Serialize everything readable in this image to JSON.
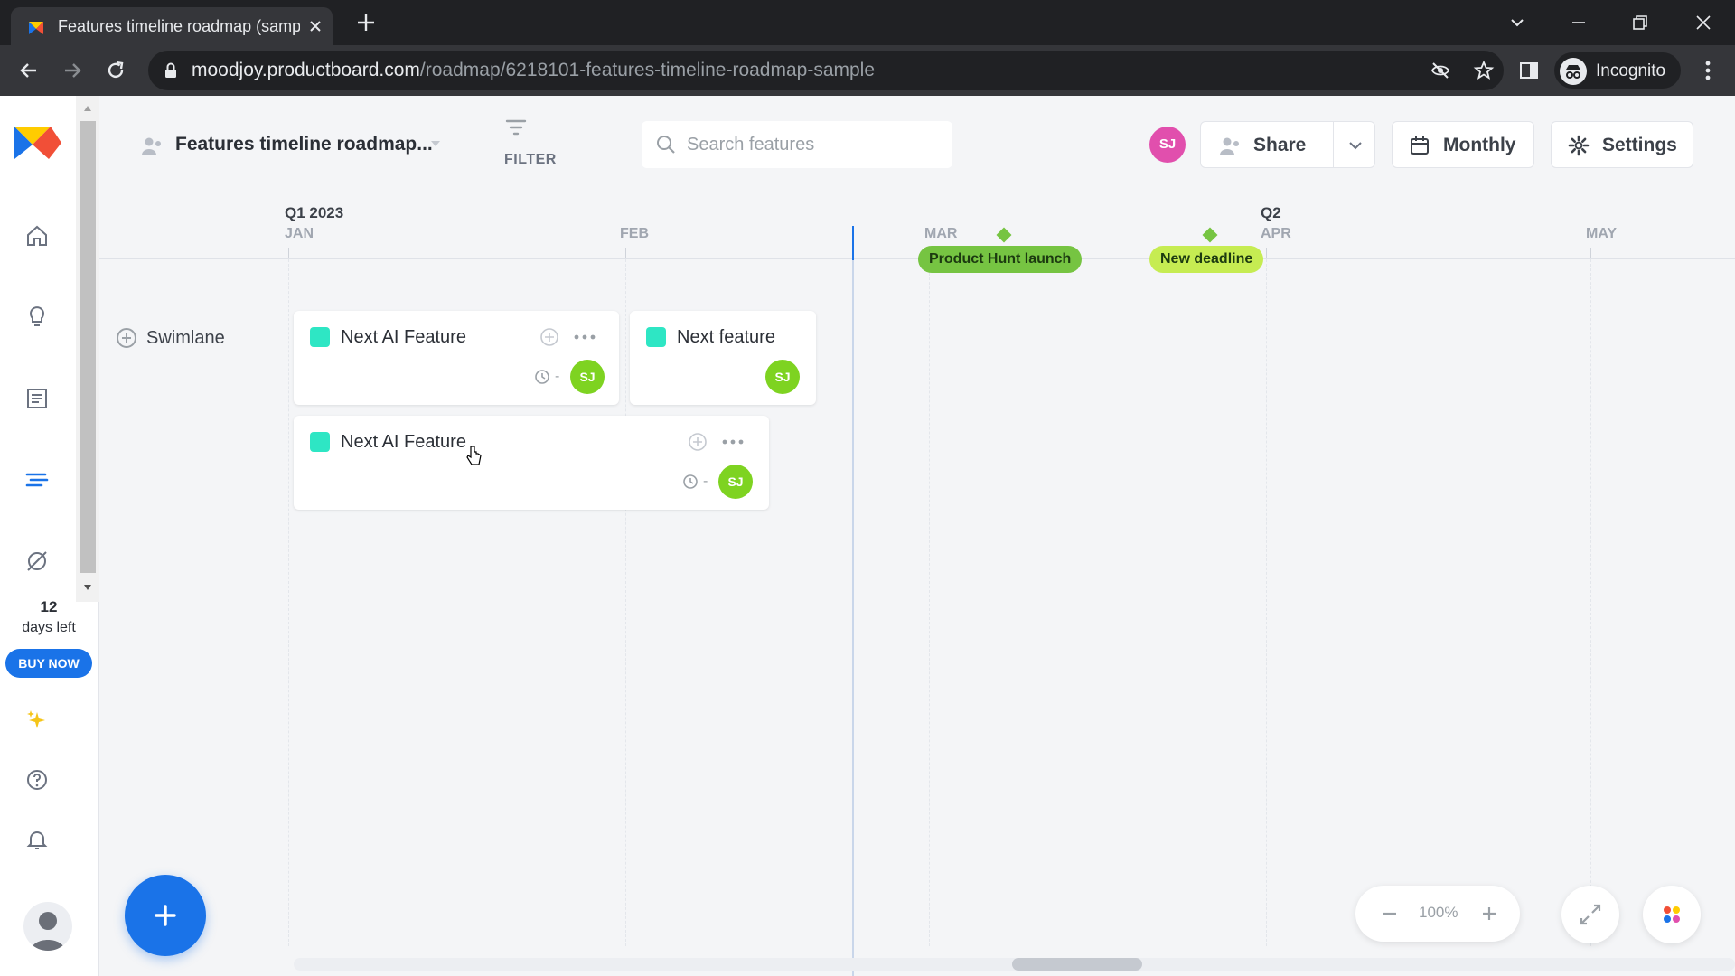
{
  "browser": {
    "tab_title": "Features timeline roadmap (samp",
    "url_domain": "moodjoy.productboard.com",
    "url_path": "/roadmap/6218101-features-timeline-roadmap-sample",
    "incognito_label": "Incognito"
  },
  "sidebar": {
    "trial_days": "12",
    "trial_label": "days left",
    "buy_label": "BUY NOW"
  },
  "toolbar": {
    "board_title": "Features timeline roadmap...",
    "filter_label": "FILTER",
    "search_placeholder": "Search features",
    "user_initials": "SJ",
    "share_label": "Share",
    "timeframe_label": "Monthly",
    "settings_label": "Settings"
  },
  "timeline": {
    "quarters": [
      {
        "label": "Q1 2023"
      },
      {
        "label": "Q2"
      }
    ],
    "months": [
      {
        "label": "JAN"
      },
      {
        "label": "FEB"
      },
      {
        "label": "MAR"
      },
      {
        "label": "APR"
      },
      {
        "label": "MAY"
      }
    ],
    "milestones": [
      {
        "label": "Product Hunt launch"
      },
      {
        "label": "New deadline"
      }
    ],
    "swimlane_label": "Swimlane",
    "cards": [
      {
        "title": "Next AI Feature",
        "date": "-",
        "owner": "SJ"
      },
      {
        "title": "Next feature",
        "owner": "SJ"
      },
      {
        "title": "Next AI Feature",
        "date": "-",
        "owner": "SJ"
      }
    ]
  },
  "zoom": {
    "level": "100%"
  },
  "colors": {
    "accent": "#1a73e8",
    "milestone_green": "#76c442",
    "card_swatch": "#2ee6c4",
    "avatar_green": "#7ed321",
    "avatar_pink": "#e14fad"
  }
}
